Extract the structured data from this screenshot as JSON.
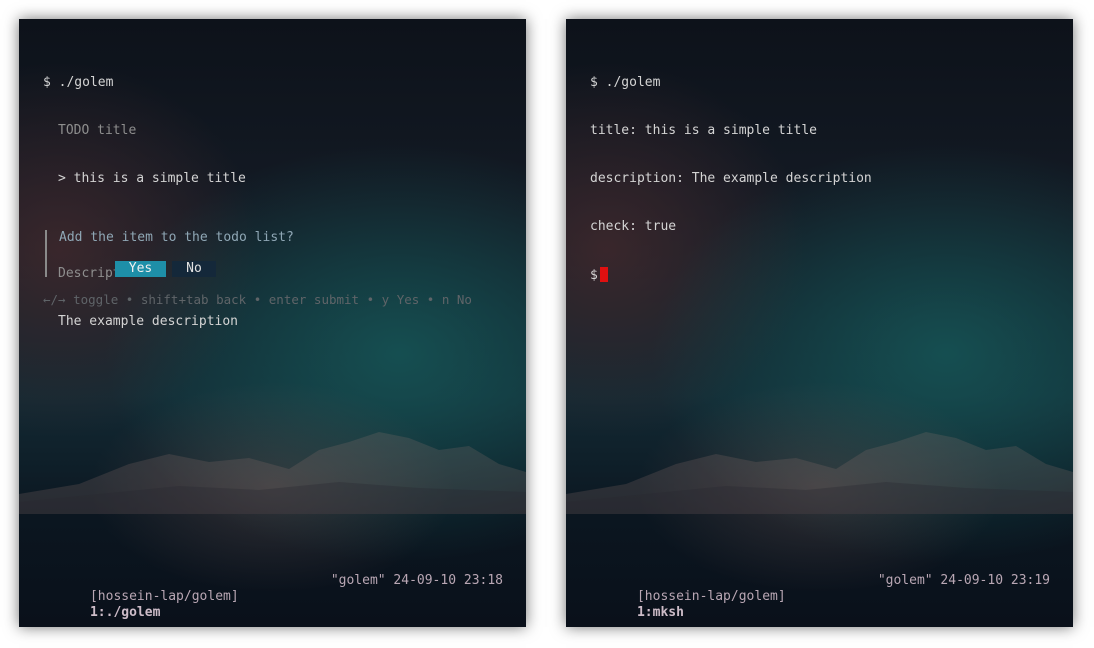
{
  "left_terminal": {
    "command": "$ ./golem",
    "title_label": "TODO title",
    "title_prompt": "> ",
    "title_value": "this is a simple title",
    "description_label": "Description",
    "description_value": "The example description",
    "confirm": {
      "question": "Add the item to the todo list?",
      "yes_label": "Yes",
      "no_label": "No",
      "selected": "Yes"
    },
    "help_text": "←/→ toggle • shift+tab back • enter submit • y Yes • n No",
    "status_bar": {
      "session": "[hossein-lap/golem]",
      "window": "1:./golem",
      "right": "\"golem\" 24-09-10 23:18"
    }
  },
  "right_terminal": {
    "lines": [
      "$ ./golem",
      "title: this is a simple title",
      "description: The example description",
      "check: true"
    ],
    "prompt": "$",
    "cursor_color": "#e01010",
    "status_bar": {
      "session": "[hossein-lap/golem]",
      "window": "1:mksh",
      "right": "\"golem\" 24-09-10 23:19"
    }
  },
  "colors": {
    "accent_yes": "#1e8fa8",
    "button_no": "#14283a",
    "cursor": "#e01010"
  }
}
